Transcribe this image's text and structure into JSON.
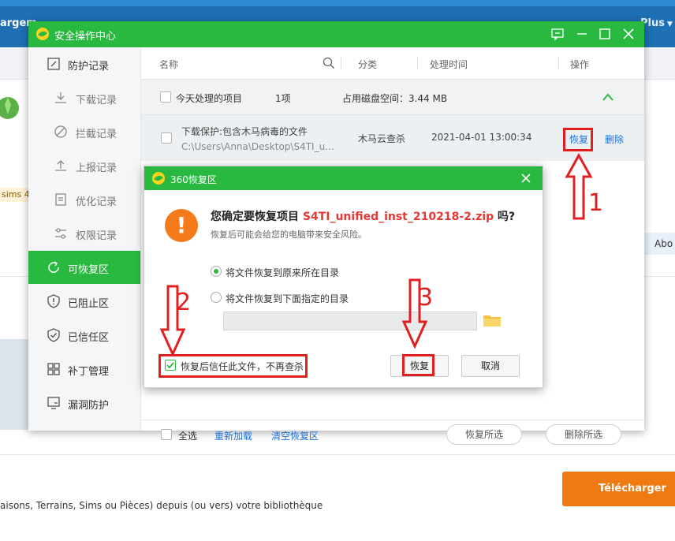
{
  "background": {
    "nav_left": "argem",
    "nav_right": "Plus",
    "badge_text": "sims 4",
    "about_text": "Abo",
    "download_button": "Télécharger ce",
    "bottom_text": "aisons, Terrains, Sims ou Pièces) depuis (ou vers) votre bibliothèque"
  },
  "main_window": {
    "title": "安全操作中心",
    "sidebar": [
      {
        "label": "防护记录",
        "icon": "shield-record-icon"
      },
      {
        "label": "下载记录",
        "icon": "download-icon"
      },
      {
        "label": "拦截记录",
        "icon": "block-icon"
      },
      {
        "label": "上报记录",
        "icon": "upload-icon"
      },
      {
        "label": "优化记录",
        "icon": "document-icon"
      },
      {
        "label": "权限记录",
        "icon": "permission-icon"
      },
      {
        "label": "可恢复区",
        "icon": "restore-icon"
      },
      {
        "label": "已阻止区",
        "icon": "shield-blocked-icon"
      },
      {
        "label": "已信任区",
        "icon": "shield-check-icon"
      },
      {
        "label": "补丁管理",
        "icon": "grid-icon"
      },
      {
        "label": "漏洞防护",
        "icon": "monitor-icon"
      }
    ],
    "columns": {
      "name": "名称",
      "category": "分类",
      "time": "处理时间",
      "action": "操作"
    },
    "group": {
      "label": "今天处理的项目",
      "count": "1项",
      "disk": "占用磁盘空间：3.44 MB"
    },
    "item": {
      "title": "下载保护:包含木马病毒的文件",
      "path": "C:\\Users\\Anna\\Desktop\\S4TI_u...",
      "category": "木马云查杀",
      "time": "2021-04-01 13:00:34",
      "restore": "恢复",
      "delete": "删除"
    },
    "footer": {
      "select_all": "全选",
      "reload": "重新加载",
      "clear": "清空恢复区",
      "restore_selected": "恢复所选",
      "delete_selected": "删除所选"
    }
  },
  "dialog": {
    "title": "360恢复区",
    "question_prefix": "您确定要恢复项目 ",
    "filename": "S4TI_unified_inst_210218-2.zip",
    "question_suffix": " 吗?",
    "subtitle": "恢复后可能会给您的电脑带来安全风险。",
    "option1": "将文件恢复到原来所在目录",
    "option2": "将文件恢复到下面指定的目录",
    "trust_checkbox": "恢复后信任此文件，不再查杀",
    "restore_button": "恢复",
    "cancel_button": "取消"
  },
  "annotations": {
    "n1": "1",
    "n2": "2",
    "n3": "3"
  },
  "colors": {
    "brand_green": "#29b941",
    "warning_orange": "#f47a1a",
    "annotation_red": "#e02020",
    "link_blue": "#1a73d9"
  }
}
